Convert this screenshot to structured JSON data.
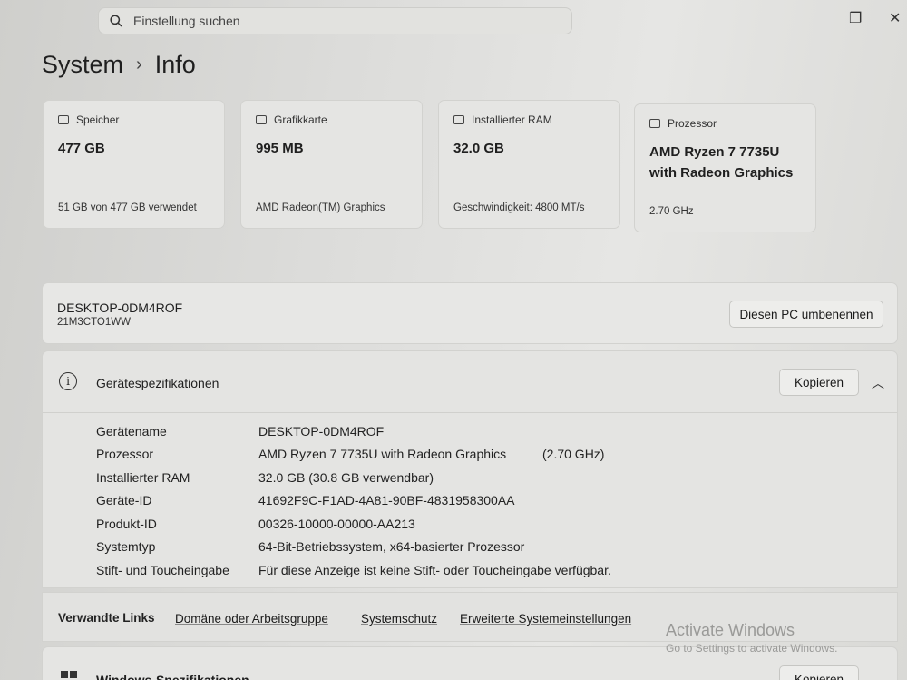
{
  "search": {
    "placeholder": "Einstellung suchen"
  },
  "breadcrumb": {
    "parent": "System",
    "current": "Info"
  },
  "cards": [
    {
      "title": "Speicher",
      "value": "477 GB",
      "sub": "51 GB von 477 GB verwendet"
    },
    {
      "title": "Grafikkarte",
      "value": "995 MB",
      "sub": "AMD Radeon(TM) Graphics"
    },
    {
      "title": "Installierter RAM",
      "value": "32.0 GB",
      "sub": "Geschwindigkeit: 4800 MT/s"
    },
    {
      "title": "Prozessor",
      "value": "AMD Ryzen 7 7735U with Radeon Graphics",
      "sub": "2.70 GHz"
    }
  ],
  "device": {
    "name": "DESKTOP-0DM4ROF",
    "model": "21M3CTO1WW",
    "rename_label": "Diesen PC umbenennen"
  },
  "specs": {
    "title": "Gerätespezifikationen",
    "copy_label": "Kopieren",
    "rows": [
      {
        "key": "Gerätename",
        "value": "DESKTOP-0DM4ROF"
      },
      {
        "key": "Prozessor",
        "value": "AMD Ryzen 7 7735U with Radeon Graphics",
        "extra": "(2.70 GHz)"
      },
      {
        "key": "Installierter RAM",
        "value": "32.0 GB (30.8 GB verwendbar)"
      },
      {
        "key": "Geräte-ID",
        "value": "41692F9C-F1AD-4A81-90BF-4831958300AA"
      },
      {
        "key": "Produkt-ID",
        "value": "00326-10000-00000-AA213"
      },
      {
        "key": "Systemtyp",
        "value": "64-Bit-Betriebssystem, x64-basierter Prozessor"
      },
      {
        "key": "Stift- und Toucheingabe",
        "value": "Für diese Anzeige ist keine Stift- oder Toucheingabe verfügbar."
      }
    ]
  },
  "related": {
    "label": "Verwandte Links",
    "links": [
      "Domäne oder Arbeitsgruppe",
      "Systemschutz",
      "Erweiterte Systemeinstellungen"
    ]
  },
  "watermark": {
    "line1": "Activate Windows",
    "line2": "Go to Settings to activate Windows."
  },
  "winspec": {
    "title": "Windows-Spezifikationen",
    "copy_label": "Kopieren"
  }
}
